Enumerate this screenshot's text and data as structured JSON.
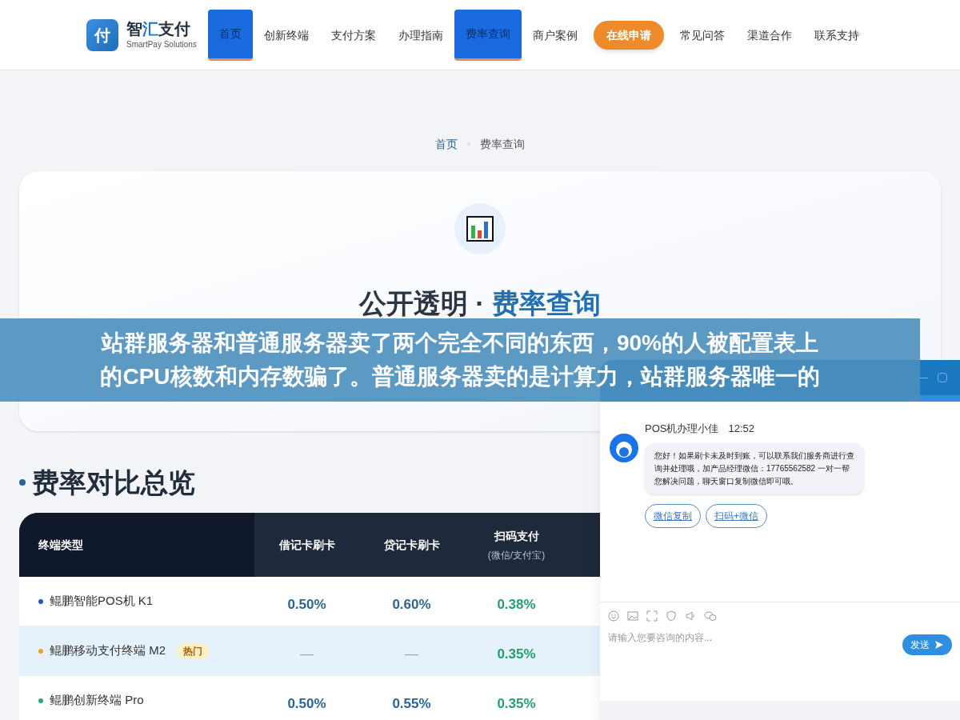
{
  "brand": {
    "logo_char": "付",
    "name_start": "智",
    "name_accent": "汇",
    "name_end": "支付",
    "tagline": "SmartPay Solutions"
  },
  "nav": [
    {
      "label": "首页",
      "kind": "link",
      "selected": true
    },
    {
      "label": "创新终端",
      "kind": "link",
      "selected": false
    },
    {
      "label": "支付方案",
      "kind": "link",
      "selected": false
    },
    {
      "label": "办理指南",
      "kind": "link",
      "selected": false
    },
    {
      "label": "费率查询",
      "kind": "link",
      "selected": true
    },
    {
      "label": "商户案例",
      "kind": "link",
      "selected": false
    },
    {
      "label": "在线申请",
      "kind": "cta",
      "selected": false
    },
    {
      "label": "常见问答",
      "kind": "link",
      "selected": false
    },
    {
      "label": "渠道合作",
      "kind": "link",
      "selected": false
    },
    {
      "label": "联系支持",
      "kind": "link",
      "selected": false
    }
  ],
  "breadcrumb": [
    {
      "label": "首页",
      "kind": "link"
    },
    {
      "label": "费率查询",
      "kind": "current"
    }
  ],
  "hero": {
    "title_main": "公开透明 · ",
    "title_accent": "费率查询"
  },
  "overlay_banner": {
    "lines": [
      "站群服务器和普通服务器卖了两个完全不同的东西，90%的人被配置表上",
      "的CPU核数和内存数骗了。普通服务器卖的是计算力，站群服务器唯一的"
    ]
  },
  "section": {
    "title": "费率对比总览"
  },
  "table": {
    "columns": [
      {
        "label": "终端类型"
      },
      {
        "label": "借记卡刷卡"
      },
      {
        "label": "贷记卡刷卡"
      },
      {
        "label": "扫码支付",
        "sublabel": "(微信/支付宝)"
      }
    ],
    "rows": [
      {
        "highlighted": false,
        "cells": [
          {
            "value": "鲲鹏智能POS机 K1",
            "kind": "terminal",
            "color": "#2b50c8"
          },
          {
            "value": "0.50%",
            "kind": "card"
          },
          {
            "value": "0.60%",
            "kind": "card"
          },
          {
            "value": "0.38%",
            "kind": "scan"
          }
        ]
      },
      {
        "highlighted": true,
        "cells": [
          {
            "value": "鲲鹏移动支付终端 M2",
            "kind": "terminal",
            "color": "#f0a020",
            "badge": "热门"
          },
          {
            "value": "—",
            "kind": "none"
          },
          {
            "value": "—",
            "kind": "none"
          },
          {
            "value": "0.35%",
            "kind": "scan"
          }
        ]
      },
      {
        "highlighted": false,
        "cells": [
          {
            "value": "鲲鹏创新终端 Pro",
            "kind": "terminal",
            "color": "#1fae7a"
          },
          {
            "value": "0.50%",
            "kind": "card"
          },
          {
            "value": "0.55%",
            "kind": "card"
          },
          {
            "value": "0.35%",
            "kind": "scan"
          }
        ]
      }
    ]
  },
  "chat": {
    "agent": "POS机办理小佳",
    "time": "12:52",
    "message": "您好！如果刷卡未及时到账，可以联系我们服务商进行查询并处理哦，加产品经理微信：17765562582 一对一帮您解决问题，聊天窗口复制微信即可哦。",
    "actions": [
      "微信复制",
      "扫码+微信"
    ],
    "placeholder": "请输入您要咨询的内容...",
    "send": "发送"
  }
}
